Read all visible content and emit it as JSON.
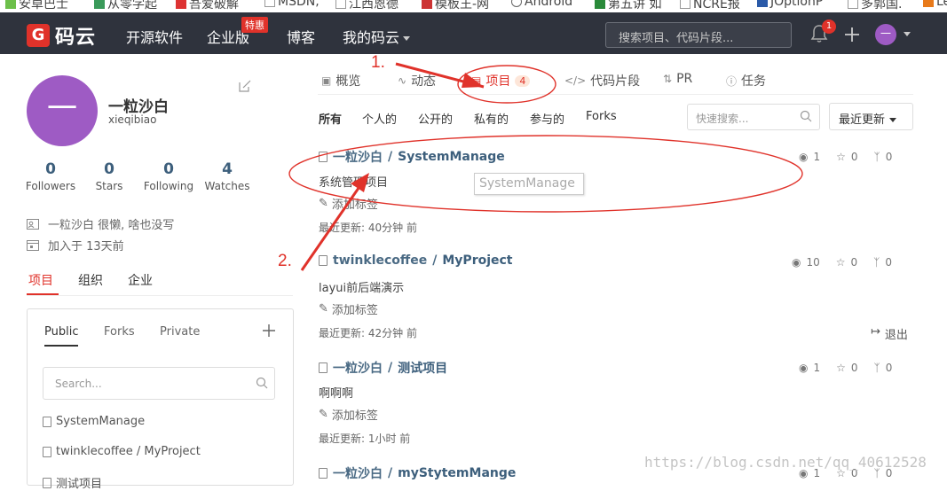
{
  "bookmarks": [
    "安卓巴士",
    "从零学起",
    "吾爱破解",
    "MSDN,",
    "江西恩德",
    "模板王-网",
    "Android",
    "第五讲 如",
    "NCRE报",
    "JOptionP",
    "多郭国.",
    "Le"
  ],
  "header": {
    "logo_text": "码云",
    "nav": [
      "开源软件",
      "企业版",
      "博客",
      "我的码云"
    ],
    "enterprise_badge": "特惠",
    "search_placeholder": "搜索项目、代码片段...",
    "notification_count": "1",
    "avatar_text": "一"
  },
  "profile": {
    "avatar_text": "一",
    "name": "一粒沙白",
    "login": "xieqibiao",
    "stats": [
      {
        "value": "0",
        "label": "Followers"
      },
      {
        "value": "0",
        "label": "Stars"
      },
      {
        "value": "0",
        "label": "Following"
      },
      {
        "value": "4",
        "label": "Watches"
      }
    ],
    "bio": "一粒沙白 很懒, 啥也没写",
    "joined": "加入于 13天前"
  },
  "left_tabs": [
    "项目",
    "组织",
    "企业"
  ],
  "repo_panel": {
    "tabs": [
      "Public",
      "Forks",
      "Private"
    ],
    "search_placeholder": "Search...",
    "items": [
      "SystemManage",
      "twinklecoffee / MyProject",
      "测试项目"
    ]
  },
  "main_tabs": [
    {
      "label": "概览"
    },
    {
      "label": "动态"
    },
    {
      "label": "项目",
      "count": "4"
    },
    {
      "label": "代码片段"
    },
    {
      "label": "PR"
    },
    {
      "label": "任务"
    }
  ],
  "filters": [
    "所有",
    "个人的",
    "公开的",
    "私有的",
    "参与的",
    "Forks"
  ],
  "quick_search_placeholder": "快速搜索...",
  "sort_label": "最近更新",
  "repos": [
    {
      "owner": "一粒沙白",
      "name": "SystemManage",
      "desc": "系统管理项目",
      "tag": "添加标签",
      "updated": "最近更新: 40分钟 前",
      "watch": "1",
      "star": "0",
      "fork": "0"
    },
    {
      "owner": "twinklecoffee",
      "name": "MyProject",
      "desc": "layui前后端演示",
      "tag": "添加标签",
      "updated": "最近更新: 42分钟 前",
      "watch": "10",
      "star": "0",
      "fork": "0",
      "quit": "退出"
    },
    {
      "owner": "一粒沙白",
      "name": "测试项目",
      "desc": "啊啊啊",
      "tag": "添加标签",
      "updated": "最近更新: 1小时 前",
      "watch": "1",
      "star": "0",
      "fork": "0"
    },
    {
      "owner": "一粒沙白",
      "name": "myStytemMange",
      "watch": "1",
      "star": "0",
      "fork": "0"
    }
  ],
  "tooltip": "SystemManage",
  "annotations": [
    "1.",
    "2."
  ],
  "watermark": "https://blog.csdn.net/qq_40612528",
  "colors": {
    "navbar": "#2f333d",
    "accent": "#e0322a",
    "avatar": "#9e5bc4",
    "link": "#3d5f7c"
  }
}
